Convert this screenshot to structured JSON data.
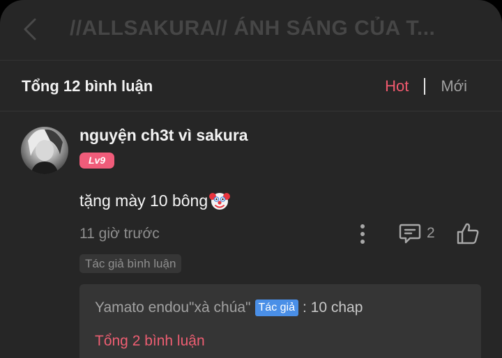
{
  "header": {
    "title": "//ALLSAKURA// ÁNH SÁNG CỦA T..."
  },
  "comments_bar": {
    "title": "Tổng 12 bình luận",
    "sort_hot": "Hot",
    "sort_new": "Mới"
  },
  "comment": {
    "username": "nguyện ch3t vì sakura",
    "level": "Lv9",
    "text": "tặng mày 10 bông",
    "emoji_icon": "clown-face-icon",
    "time": "11 giờ trước",
    "reply_count": "2",
    "author_tag": "Tác giả bình luận"
  },
  "reply_preview": {
    "author": "Yamato endou\"xà chúa\"",
    "badge": "Tác giả",
    "text": ": 10 chap",
    "total": "Tổng 2 bình luận"
  },
  "colors": {
    "accent_pink": "#f0596e",
    "badge_blue": "#4a8fe7",
    "background": "#262626"
  }
}
